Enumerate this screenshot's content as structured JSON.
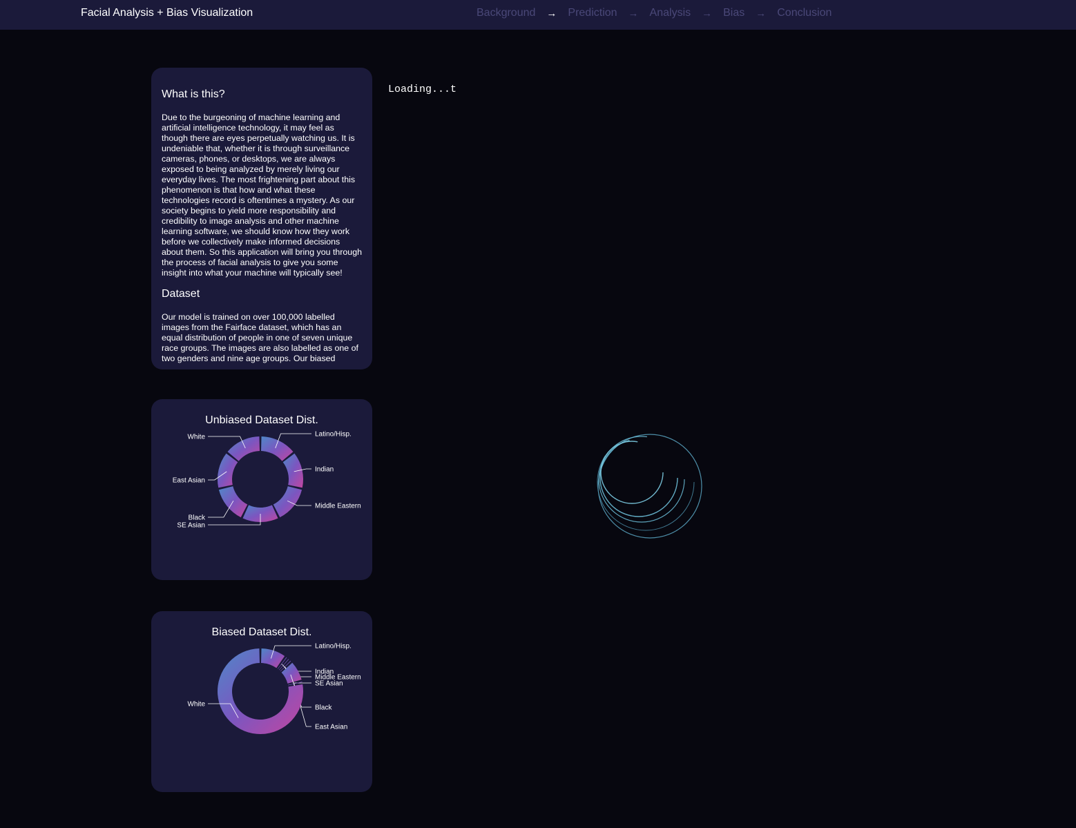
{
  "header": {
    "title": "Facial Analysis + Bias Visualization",
    "nav": [
      "Background",
      "Prediction",
      "Analysis",
      "Bias",
      "Conclusion"
    ],
    "arrow": "→"
  },
  "info": {
    "what_heading": "What is this?",
    "what_body": "Due to the burgeoning of machine learning and artificial intelligence technology, it may feel as though there are eyes perpetually watching us. It is undeniable that, whether it is through surveillance cameras, phones, or desktops, we are always exposed to being analyzed by merely living our everyday lives. The most frightening part about this phenomenon is that how and what these technologies record is oftentimes a mystery. As our society begins to yield more responsibility and credibility to image analysis and other machine learning software, we should know how they work before we collectively make informed decisions about them. So this application will bring you through the process of facial analysis to give you some insight into what your machine will typically see!",
    "dataset_heading": "Dataset",
    "dataset_body": "Our model is trained on over 100,000 labelled images from the Fairface dataset, which has an equal distribution of people in one of seven unique race groups. The images are also labelled as one of two genders and nine age groups. Our biased"
  },
  "loading_text": "Loading...t",
  "chart_data": [
    {
      "type": "pie",
      "title": "Unbiased Dataset Dist.",
      "categories": [
        "Latino/Hisp.",
        "Indian",
        "Middle Eastern",
        "SE Asian",
        "Black",
        "East Asian",
        "White"
      ],
      "values": [
        14.3,
        14.3,
        14.3,
        14.3,
        14.3,
        14.3,
        14.3
      ]
    },
    {
      "type": "pie",
      "title": "Biased Dataset Dist.",
      "categories": [
        "Latino/Hisp.",
        "Indian",
        "Middle Eastern",
        "SE Asian",
        "Black",
        "East Asian",
        "White"
      ],
      "values": [
        10,
        1,
        1,
        1,
        8,
        1,
        78
      ]
    }
  ]
}
